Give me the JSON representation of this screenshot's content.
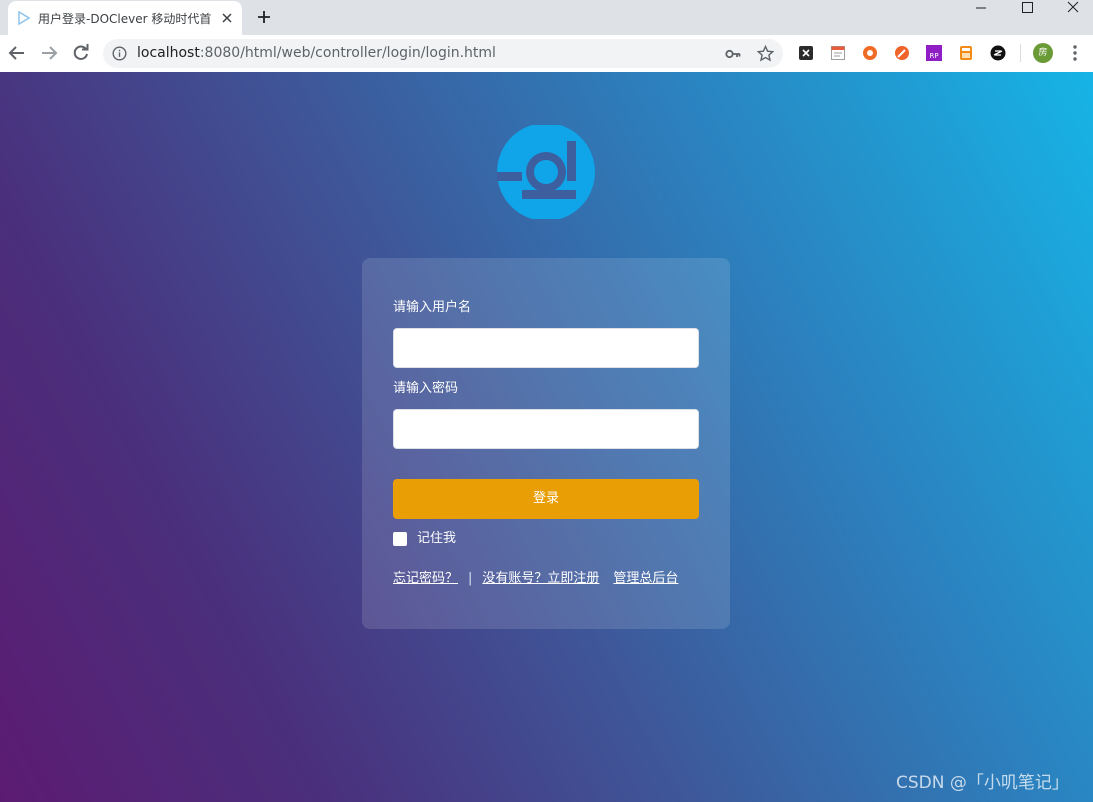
{
  "browser": {
    "tab": {
      "title": "用户登录-DOClever 移动时代首"
    },
    "address": {
      "host": "localhost",
      "path": ":8080/html/web/controller/login/login.html"
    },
    "extensions": [
      "x-extension-icon",
      "note-extension-icon",
      "lifebuoy-extension-icon",
      "rocket-extension-icon",
      "rp-extension-icon",
      "calculator-extension-icon",
      "zen-extension-icon"
    ],
    "profile_initial": "房"
  },
  "page": {
    "logo_color": "#0fa5e8",
    "login": {
      "username_label": "请输入用户名",
      "username_value": "",
      "password_label": "请输入密码",
      "password_value": "",
      "submit_label": "登录",
      "remember_label": "记住我",
      "remember_checked": false,
      "forgot_link": "忘记密码？",
      "separator": "|",
      "register_link": "没有账号？立即注册",
      "admin_link": "管理总后台"
    },
    "button_color": "#e99e06"
  },
  "watermark": "CSDN @「小叽笔记」"
}
